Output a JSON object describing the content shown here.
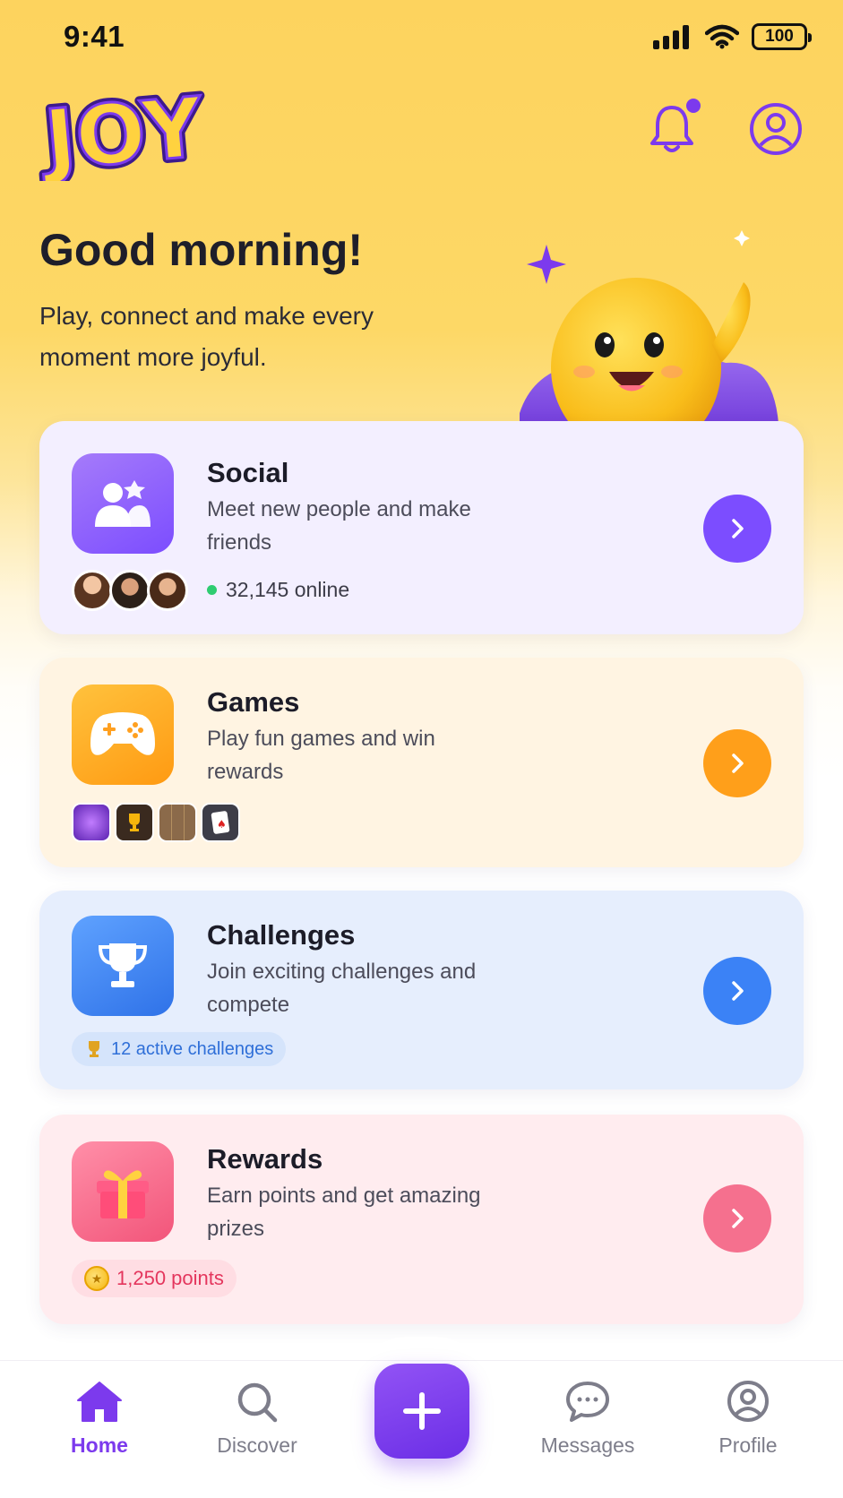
{
  "status_bar": {
    "time": "9:41",
    "battery": "100"
  },
  "app": {
    "logo_text": "JOY"
  },
  "greeting": {
    "title": "Good morning!",
    "subtitle": "Play, connect and make every moment more joyful."
  },
  "cards": {
    "social": {
      "title": "Social",
      "description": "Meet new people and make friends",
      "online_text": "32,145 online",
      "accent": "#7c4dff"
    },
    "games": {
      "title": "Games",
      "description": "Play fun games and win rewards",
      "accent": "#ff9f1a"
    },
    "challenges": {
      "title": "Challenges",
      "description": "Join exciting challenges and compete",
      "badge": "12 active challenges",
      "accent": "#3b82f6"
    },
    "rewards": {
      "title": "Rewards",
      "description": "Earn points and get amazing prizes",
      "badge": "1,250 points",
      "accent": "#f25c7e"
    }
  },
  "bottom_nav": {
    "items": [
      {
        "label": "Home",
        "icon": "home-icon",
        "active": true
      },
      {
        "label": "Discover",
        "icon": "search-icon",
        "active": false
      },
      {
        "label": "Messages",
        "icon": "chat-icon",
        "active": false
      },
      {
        "label": "Profile",
        "icon": "profile-icon",
        "active": false
      }
    ],
    "fab_icon": "plus-icon"
  },
  "colors": {
    "brand": "#7c3aed",
    "header_bg": "#fdd35e"
  }
}
